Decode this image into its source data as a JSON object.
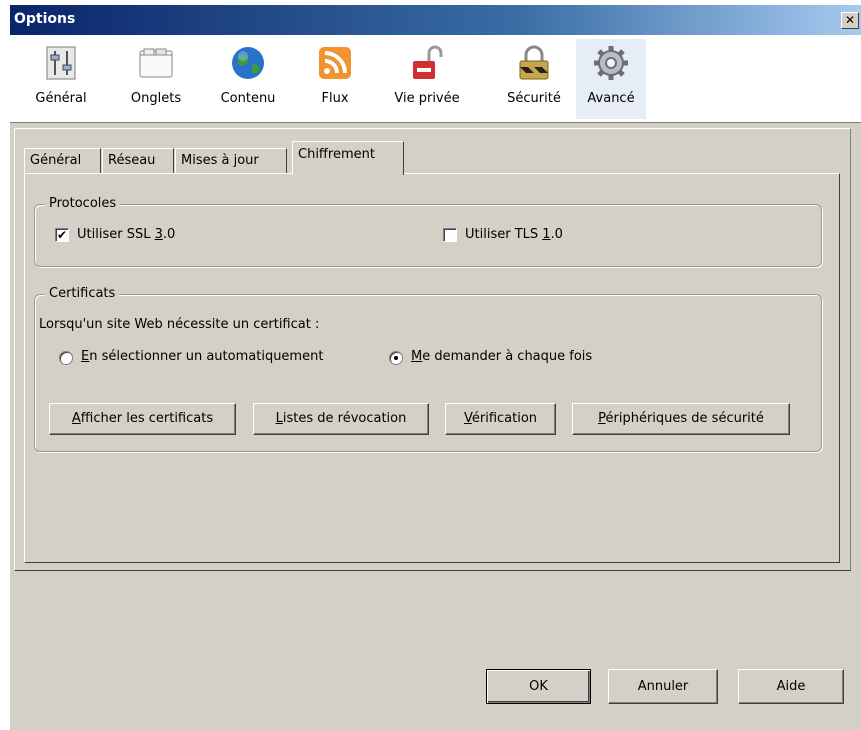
{
  "window": {
    "title": "Options",
    "close_symbol": "✕"
  },
  "toolbar": {
    "items": [
      {
        "label": "Général",
        "icon": "sliders-icon"
      },
      {
        "label": "Onglets",
        "icon": "tabs-window-icon"
      },
      {
        "label": "Contenu",
        "icon": "globe-icon"
      },
      {
        "label": "Flux",
        "icon": "rss-feed-icon"
      },
      {
        "label": "Vie privée",
        "icon": "unlocked-padlock-icon"
      },
      {
        "label": "Sécurité",
        "icon": "padlock-icon"
      },
      {
        "label": "Avancé",
        "icon": "gear-icon"
      }
    ],
    "selected": "Avancé"
  },
  "subtabs": {
    "items": [
      "Général",
      "Réseau",
      "Mises à jour",
      "Chiffrement"
    ],
    "active": "Chiffrement"
  },
  "protocoles": {
    "legend": "Protocoles",
    "ssl": {
      "pre": "Utiliser SSL ",
      "mnemonic": "3",
      "post": ".0",
      "checked": true,
      "check_mark": "✔"
    },
    "tls": {
      "pre": "Utiliser TLS ",
      "mnemonic": "1",
      "post": ".0",
      "checked": false
    }
  },
  "certificats": {
    "legend": "Certificats",
    "prompt": "Lorsqu'un site Web nécessite un certificat :",
    "radio_auto": {
      "mnemonic": "E",
      "rest": "n sélectionner un automatiquement",
      "selected": false
    },
    "radio_ask": {
      "mnemonic": "M",
      "rest": "e demander à chaque fois",
      "selected": true
    },
    "buttons": {
      "show": {
        "mnemonic": "A",
        "rest": "fficher les certificats"
      },
      "revocation": {
        "mnemonic": "L",
        "rest": "istes de révocation"
      },
      "verification": {
        "mnemonic": "V",
        "rest": "érification"
      },
      "devices": {
        "mnemonic": "P",
        "rest": "ériphériques de sécurité"
      }
    }
  },
  "footer": {
    "ok": "OK",
    "cancel": "Annuler",
    "help": "Aide"
  }
}
